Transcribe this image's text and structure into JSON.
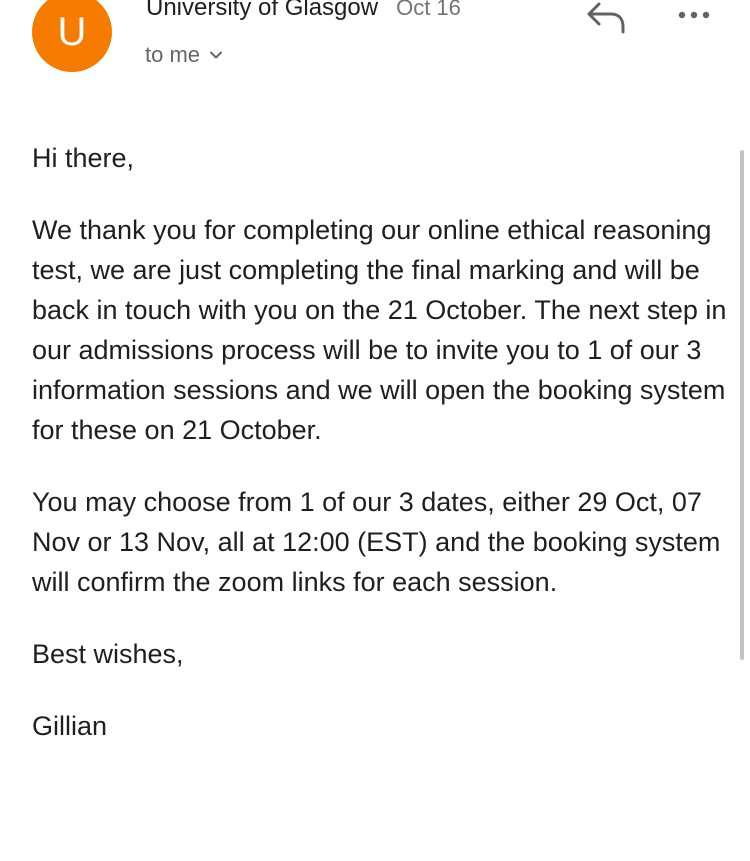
{
  "header": {
    "avatar_letter": "U",
    "avatar_color": "#f57c00",
    "sender": "University of Glasgow",
    "date": "Oct 16",
    "recipient": "to me",
    "icons": {
      "reply": "reply-icon",
      "more": "more-options-icon",
      "expand": "chevron-down-icon"
    }
  },
  "body": {
    "greeting": "Hi there,",
    "paragraph_1": "We thank you for completing our online ethical reasoning test, we are just completing the final marking and will be back in touch with you on the 21 October.  The next step in our admissions process will be to invite you to 1 of our 3 information sessions and we will open the booking system for these on 21 October.",
    "paragraph_2": "You may choose from 1 of our 3 dates, either 29 Oct, 07 Nov or 13 Nov, all at 12:00 (EST) and the booking system will confirm the zoom links for each session.",
    "signoff": "Best wishes,",
    "signature": "Gillian"
  }
}
